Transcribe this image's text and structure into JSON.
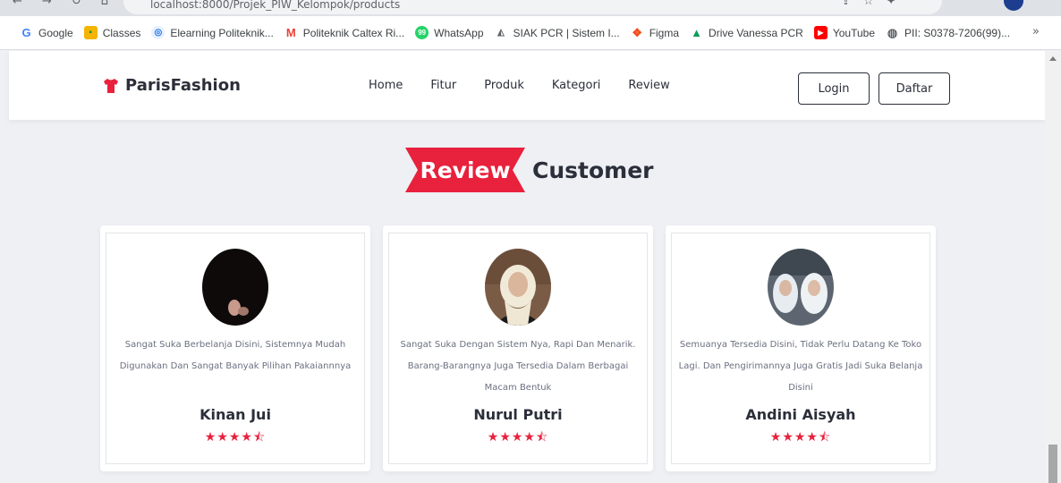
{
  "browser": {
    "url_text": "localhost:8000/Projek_PIW_Kelompok/products",
    "bookmarks": [
      {
        "label": "Google",
        "icon": "google-icon",
        "color": "#4285f4"
      },
      {
        "label": "Classes",
        "icon": "classes-icon",
        "color": "#f4b400"
      },
      {
        "label": "Elearning Politeknik...",
        "icon": "elearning-icon",
        "color": "#1a73e8"
      },
      {
        "label": "Politeknik Caltex Ri...",
        "icon": "gmail-icon",
        "color": "#ea4335"
      },
      {
        "label": "WhatsApp",
        "icon": "whatsapp-icon",
        "color": "#25d366"
      },
      {
        "label": "SIAK PCR | Sistem I...",
        "icon": "siak-icon",
        "color": "#5f6368"
      },
      {
        "label": "Figma",
        "icon": "figma-icon",
        "color": "#f24e1e"
      },
      {
        "label": "Drive Vanessa PCR",
        "icon": "drive-icon",
        "color": "#0f9d58"
      },
      {
        "label": "YouTube",
        "icon": "youtube-icon",
        "color": "#ff0000"
      },
      {
        "label": "PII: S0378-7206(99)...",
        "icon": "globe-icon",
        "color": "#5f6368"
      }
    ],
    "more": "»"
  },
  "navbar": {
    "brand": "ParisFashion",
    "brand_color": "#e8213c",
    "links": [
      "Home",
      "Fitur",
      "Produk",
      "Kategori",
      "Review"
    ],
    "login": "Login",
    "daftar": "Daftar"
  },
  "section": {
    "tag": "Review",
    "rest": "Customer",
    "accent": "#e8213c"
  },
  "reviews": [
    {
      "quote": "Sangat Suka Berbelanja Disini, Sistemnya Mudah Digunakan Dan Sangat Banyak Pilihan Pakaiannnya",
      "name": "Kinan Jui",
      "stars": "★★★★⯪",
      "rating": 4.5
    },
    {
      "quote": "Sangat Suka Dengan Sistem Nya, Rapi Dan Menarik. Barang-Barangnya Juga Tersedia Dalam Berbagai Macam Bentuk",
      "name": "Nurul Putri",
      "stars": "★★★★⯪",
      "rating": 4.5
    },
    {
      "quote": "Semuanya Tersedia Disini, Tidak Perlu Datang Ke Toko Lagi. Dan Pengirimannya Juga Gratis Jadi Suka Belanja Disini",
      "name": "Andini Aisyah",
      "stars": "★★★★⯪",
      "rating": 4.5
    }
  ]
}
